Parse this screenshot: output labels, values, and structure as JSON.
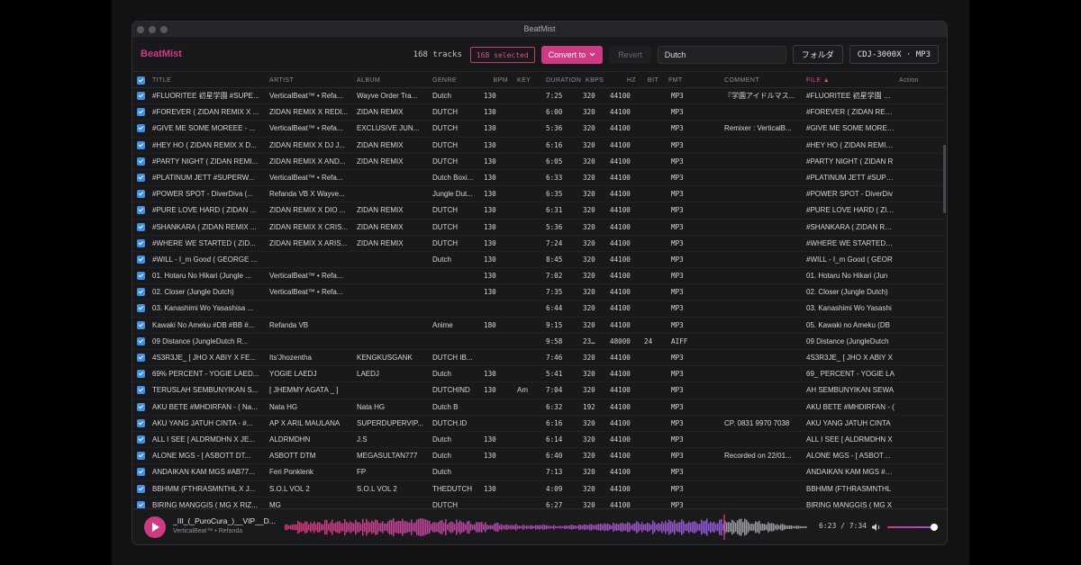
{
  "window": {
    "title": "BeatMist"
  },
  "app": {
    "brand": "BeatMist"
  },
  "toolbar": {
    "tracks_count": "168 tracks",
    "selected_badge": "168 selected",
    "convert_label": "Convert to",
    "revert_label": "Revert",
    "search_value": "Dutch",
    "folder_label": "フォルダ",
    "device_label": "CDJ-3000X · MP3"
  },
  "table": {
    "headers": {
      "title": "TITLE",
      "artist": "ARTIST",
      "album": "ALBUM",
      "genre": "GENRE",
      "bpm": "BPM",
      "key": "KEY",
      "duration": "DURATION",
      "kbps": "KBPS",
      "hz": "HZ",
      "bit": "BIT",
      "fmt": "FMT",
      "comment": "COMMENT",
      "file": "FILE ▲",
      "action": "Action"
    },
    "rows": [
      {
        "title": "#FLUORITEE 初星学園 #SUPE...",
        "artist": "VerticalBeat™ • Refa...",
        "album": "Wayve Order Tra...",
        "genre": "Dutch",
        "bpm": "130",
        "key": "",
        "duration": "7:25",
        "kbps": "320",
        "hz": "44100",
        "bit": "",
        "fmt": "MP3",
        "comment": "『学園アイドルマス...",
        "file": "#FLUORITEE 初星学園 #SU"
      },
      {
        "title": "#FOREVER ( ZIDAN REMIX X ...",
        "artist": "ZIDAN REMIX X REDI...",
        "album": "ZIDAN REMIX",
        "genre": "DUTCH",
        "bpm": "130",
        "key": "",
        "duration": "6:00",
        "kbps": "320",
        "hz": "44100",
        "bit": "",
        "fmt": "MP3",
        "comment": "",
        "file": "#FOREVER ( ZIDAN REMIX"
      },
      {
        "title": "#GIVE ME SOME MOREEE - ...",
        "artist": "VerticalBeat™ • Refa...",
        "album": "EXCLUSIVE JUN...",
        "genre": "DUTCH",
        "bpm": "130",
        "key": "",
        "duration": "5:36",
        "kbps": "320",
        "hz": "44100",
        "bit": "",
        "fmt": "MP3",
        "comment": "Remixer : VerticalB...",
        "file": "#GIVE ME SOME MOREEE"
      },
      {
        "title": "#HEY HO ( ZIDAN REMIX X D...",
        "artist": "ZIDAN REMIX X DJ J...",
        "album": "ZIDAN REMIX",
        "genre": "DUTCH",
        "bpm": "130",
        "key": "",
        "duration": "6:16",
        "kbps": "320",
        "hz": "44100",
        "bit": "",
        "fmt": "MP3",
        "comment": "",
        "file": "#HEY HO ( ZIDAN REMIX X"
      },
      {
        "title": "#PARTY NIGHT ( ZIDAN REMI...",
        "artist": "ZIDAN REMIX X AND...",
        "album": "ZIDAN REMIX",
        "genre": "DUTCH",
        "bpm": "130",
        "key": "",
        "duration": "6:05",
        "kbps": "320",
        "hz": "44100",
        "bit": "",
        "fmt": "MP3",
        "comment": "",
        "file": "#PARTY NIGHT ( ZIDAN R"
      },
      {
        "title": "#PLATINUM JETT #SUPERW...",
        "artist": "VerticalBeat™ • Refa...",
        "album": "",
        "genre": "Dutch Boxi...",
        "bpm": "130",
        "key": "",
        "duration": "6:33",
        "kbps": "320",
        "hz": "44100",
        "bit": "",
        "fmt": "MP3",
        "comment": "",
        "file": "#PLATINUM JETT #SUPEF"
      },
      {
        "title": "#POWER SPOT - DiverDiva (...",
        "artist": "Refanda VB X Wayve...",
        "album": "",
        "genre": "Jungle Dut...",
        "bpm": "130",
        "key": "",
        "duration": "6:35",
        "kbps": "320",
        "hz": "44100",
        "bit": "",
        "fmt": "MP3",
        "comment": "",
        "file": "#POWER SPOT - DiverDiv"
      },
      {
        "title": "#PURE LOVE HARD ( ZIDAN ...",
        "artist": "ZIDAN REMIX X DIO ...",
        "album": "ZIDAN REMIX",
        "genre": "DUTCH",
        "bpm": "130",
        "key": "",
        "duration": "6:31",
        "kbps": "320",
        "hz": "44100",
        "bit": "",
        "fmt": "MP3",
        "comment": "",
        "file": "#PURE LOVE HARD ( ZIDA"
      },
      {
        "title": "#SHANKARA ( ZIDAN REMIX ...",
        "artist": "ZIDAN REMIX X CRIS...",
        "album": "ZIDAN REMIX",
        "genre": "DUTCH",
        "bpm": "130",
        "key": "",
        "duration": "5:36",
        "kbps": "320",
        "hz": "44100",
        "bit": "",
        "fmt": "MP3",
        "comment": "",
        "file": "#SHANKARA ( ZIDAN REM"
      },
      {
        "title": "#WHERE WE STARTED ( ZID...",
        "artist": "ZIDAN REMIX X ARIS...",
        "album": "ZIDAN REMIX",
        "genre": "DUTCH",
        "bpm": "130",
        "key": "",
        "duration": "7:24",
        "kbps": "320",
        "hz": "44100",
        "bit": "",
        "fmt": "MP3",
        "comment": "",
        "file": "#WHERE WE STARTED ( 2"
      },
      {
        "title": "#WILL - I_m Good ( GEORGE ...",
        "artist": "",
        "album": "",
        "genre": "Dutch",
        "bpm": "130",
        "key": "",
        "duration": "8:45",
        "kbps": "320",
        "hz": "44100",
        "bit": "",
        "fmt": "MP3",
        "comment": "",
        "file": "#WILL - I_m Good ( GEOR"
      },
      {
        "title": "01. Hotaru No Hikari (Jungle ...",
        "artist": "VerticalBeat™ • Refa...",
        "album": "",
        "genre": "",
        "bpm": "130",
        "key": "",
        "duration": "7:02",
        "kbps": "320",
        "hz": "44100",
        "bit": "",
        "fmt": "MP3",
        "comment": "",
        "file": "01. Hotaru No Hikari (Jun"
      },
      {
        "title": "02. Closer (Jungle Dutch)",
        "artist": "VerticalBeat™ • Refa...",
        "album": "",
        "genre": "",
        "bpm": "130",
        "key": "",
        "duration": "7:35",
        "kbps": "320",
        "hz": "44100",
        "bit": "",
        "fmt": "MP3",
        "comment": "",
        "file": "02. Closer (Jungle Dutch)"
      },
      {
        "title": "03. Kanashimi Wo Yasashisa ...",
        "artist": "",
        "album": "",
        "genre": "",
        "bpm": "",
        "key": "",
        "duration": "6:44",
        "kbps": "320",
        "hz": "44100",
        "bit": "",
        "fmt": "MP3",
        "comment": "",
        "file": "03. Kanashimi Wo Yasashi"
      },
      {
        "title": "Kawaki No Ameku #DB #BB #...",
        "artist": "Refanda VB",
        "album": "",
        "genre": "Anime",
        "bpm": "180",
        "key": "",
        "duration": "9:15",
        "kbps": "320",
        "hz": "44100",
        "bit": "",
        "fmt": "MP3",
        "comment": "",
        "file": "05. Kawaki no Ameku (DB"
      },
      {
        "title": "09 Distance (JungleDutch R...",
        "artist": "",
        "album": "",
        "genre": "",
        "bpm": "",
        "key": "",
        "duration": "9:58",
        "kbps": "2304",
        "hz": "48000",
        "bit": "24",
        "fmt": "AIFF",
        "comment": "",
        "file": "09 Distance (JungleDutch"
      },
      {
        "title": "4S3R3JE_ [ JHO X ABIY X FE...",
        "artist": "Its'Jhozentha",
        "album": "KENGKUSGANK",
        "genre": "DUTCH IB...",
        "bpm": "",
        "key": "",
        "duration": "7:46",
        "kbps": "320",
        "hz": "44100",
        "bit": "",
        "fmt": "MP3",
        "comment": "",
        "file": "4S3R3JE_ [ JHO X ABIY X"
      },
      {
        "title": "69% PERCENT - YOGIE LAED...",
        "artist": "YOGIE LAEDJ",
        "album": "LAEDJ",
        "genre": "Dutch",
        "bpm": "130",
        "key": "",
        "duration": "5:41",
        "kbps": "320",
        "hz": "44100",
        "bit": "",
        "fmt": "MP3",
        "comment": "",
        "file": "69_ PERCENT - YOGIE LA"
      },
      {
        "title": "TERUSLAH SEMBUNYIKAN S...",
        "artist": "[ JHEMMY AGATA _ ]",
        "album": "",
        "genre": "DUTCHIND",
        "bpm": "130",
        "key": "Am",
        "duration": "7:04",
        "kbps": "320",
        "hz": "44100",
        "bit": "",
        "fmt": "MP3",
        "comment": "",
        "file": "AH SEMBUNYIKAN SEWA"
      },
      {
        "title": "AKU BETE #MHDIRFAN - ( Na...",
        "artist": "Nata HG",
        "album": "Nata HG",
        "genre": "Dutch B",
        "bpm": "",
        "key": "",
        "duration": "6:32",
        "kbps": "192",
        "hz": "44100",
        "bit": "",
        "fmt": "MP3",
        "comment": "",
        "file": "AKU BETE #MHDIRFAN - ("
      },
      {
        "title": "AKU YANG JATUH CINTA - #...",
        "artist": "AP X ARIL MAULANA",
        "album": "SUPERDUPERVIP...",
        "genre": "DUTCH.ID",
        "bpm": "",
        "key": "",
        "duration": "6:16",
        "kbps": "320",
        "hz": "44100",
        "bit": "",
        "fmt": "MP3",
        "comment": "CP. 0831 9970 7038",
        "file": "AKU YANG JATUH CINTA"
      },
      {
        "title": "ALL I SEE [ ALDRMDHN X JE...",
        "artist": "ALDRMDHN",
        "album": "J.S",
        "genre": "Dutch",
        "bpm": "130",
        "key": "",
        "duration": "6:14",
        "kbps": "320",
        "hz": "44100",
        "bit": "",
        "fmt": "MP3",
        "comment": "",
        "file": "ALL I SEE [ ALDRMDHN X"
      },
      {
        "title": "ALONE MGS - [ ASBOTT DT...",
        "artist": "ASBOTT DTM",
        "album": "MEGASULTAN777",
        "genre": "Dutch",
        "bpm": "130",
        "key": "",
        "duration": "6:40",
        "kbps": "320",
        "hz": "44100",
        "bit": "",
        "fmt": "MP3",
        "comment": "Recorded on 22/01...",
        "file": "ALONE MGS - [ ASBOTT D"
      },
      {
        "title": "ANDAIKAN KAM MGS #AB77...",
        "artist": "Feri Ponklenk",
        "album": "FP",
        "genre": "Dutch",
        "bpm": "",
        "key": "",
        "duration": "7:13",
        "kbps": "320",
        "hz": "44100",
        "bit": "",
        "fmt": "MP3",
        "comment": "",
        "file": "ANDAIKAN KAM MGS #AE"
      },
      {
        "title": "BBHMM (FTHRASMNTHL X J...",
        "artist": "S.O.L VOL 2",
        "album": "S.O.L VOL 2",
        "genre": "THEDUTCH",
        "bpm": "130",
        "key": "",
        "duration": "4:09",
        "kbps": "320",
        "hz": "44100",
        "bit": "",
        "fmt": "MP3",
        "comment": "",
        "file": "BBHMM (FTHRASMNTHL"
      },
      {
        "title": "BIRING MANGGIS ( MG X RIZ...",
        "artist": "MG",
        "album": "",
        "genre": "DUTCH",
        "bpm": "",
        "key": "",
        "duration": "6:27",
        "kbps": "320",
        "hz": "44100",
        "bit": "",
        "fmt": "MP3",
        "comment": "",
        "file": "BIRING MANGGIS ( MG X"
      }
    ]
  },
  "player": {
    "title": "_III_(_PuroCura_)__VIP__D...",
    "artist": "VerticalBeat™ • Refanda",
    "time": "6:23 / 7:34",
    "progress_fraction": 0.84,
    "volume_fraction": 1.0,
    "icons": {
      "play": "play-icon",
      "volume": "volume-icon"
    }
  },
  "colors": {
    "accent": "#cf3a84",
    "checkbox": "#3d8fe8",
    "wave_played_start": "#d33a7c",
    "wave_played_end": "#8e5ad8",
    "wave_unplayed": "#9a9aa0"
  }
}
